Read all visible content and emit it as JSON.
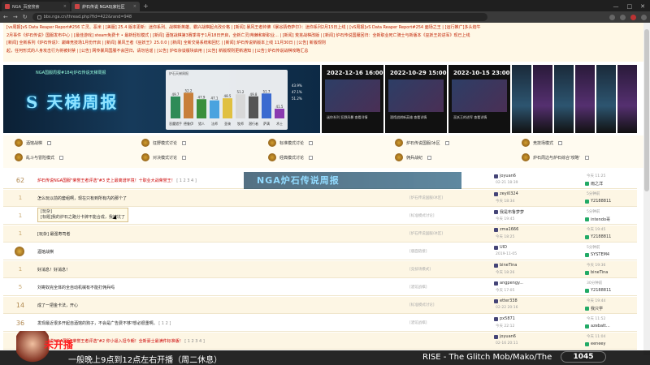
{
  "browser": {
    "tabs": [
      {
        "label": "NGA_百度搜索",
        "active": false
      },
      {
        "label": "炉石传说 NGA玩家社区",
        "active": true
      }
    ],
    "url": "bbs.nga.cn/thread.php?fid=422&rand=948"
  },
  "announce": {
    "lines": [
      "[vs周报]vS Data Reaper Report#256 亡灵、恶米 | [美服] 25.4 版本更新：迷你系列、战棋新英雄、霸兴战棋起点改价格 | [新闻] 暴风王者帅佛《暴谷猜奇萨尔》：迷你系列2月15日上线 | [vS周报]vS Data Reaper Report#254 面场之王 | [运行推广]多头炮牛",
      "2月事件《炉石传说》国服发布中心 | [最佳游戏] steam免费卡 • 最新轻松模式 | [新闻] 酒馆战棋第3赛季将于1月18日开启，全新亡灵/荆棘和新职业... | [新闻] 荒芜战棋改版 | [新闻] 炉石传说国服回归：全新职业死亡骑士与新版本《巫妖王的进军》现已上线",
      "[新闻] 全新系列《炉石传说》：巅峰竞技场1月份开启 | [新闻] 暴风王者《巫妖王》25.0.0 | [新闻] 全新交易系统和回忆 | [新闻] 炉石传说新版本上线 11月30日 | [公告] 新版规则",
      "起，任何形式的人身攻击行为将被封禁 | [公告] 网传暴风国服不会回归，请勿信谣 | [公告] 炉石杂谈版块启用 | [公告] 新版规则更新通知 | [公告] 炉石传说战棋攻略汇总"
    ]
  },
  "banner": {
    "subtitle": "NGA国服周报#184|炉石传说天梯周报",
    "title": "S 天梯周报",
    "panel_header": "炉石天梯周报",
    "class_winrates": [
      49.7,
      52.2,
      47.9,
      47.1,
      48.5,
      51.2,
      49.8,
      51.7,
      41.5
    ],
    "class_labels": [
      "恶魔猎手",
      "德鲁伊",
      "猎人",
      "法师",
      "圣骑",
      "牧师",
      "潜行者",
      "萨满",
      "术士"
    ],
    "pct_labels": [
      "43.9%",
      "47.1%",
      "51.2%"
    ],
    "cards": [
      {
        "date": "2022-12-16 16:00",
        "caption": "迷你系列 狂野风暴 查看详情"
      },
      {
        "date": "2022-10-29 15:00",
        "caption": "酒馆战棋新英雄 查看详情"
      },
      {
        "date": "2022-10-15 23:00",
        "caption": "巫妖王的进军 查看详情"
      }
    ]
  },
  "forums": [
    {
      "name": "酒馆战棋",
      "col": 0,
      "row": 0
    },
    {
      "name": "狂野模式讨论",
      "col": 1,
      "row": 0
    },
    {
      "name": "标准模式讨论",
      "col": 2,
      "row": 0
    },
    {
      "name": "炉石传说国服/冰区",
      "col": 3,
      "row": 0
    },
    {
      "name": "竞技场模式",
      "col": 4,
      "row": 0
    },
    {
      "name": "乱斗与冒险模式",
      "col": 0,
      "row": 1
    },
    {
      "name": "对决模式讨论",
      "col": 1,
      "row": 1
    },
    {
      "name": "经典模式讨论",
      "col": 2,
      "row": 1
    },
    {
      "name": "佣兵战纪",
      "col": 3,
      "row": 1
    },
    {
      "name": "炉石周边与炉石综合'攻略'",
      "col": 4,
      "row": 1
    }
  ],
  "threads": [
    {
      "count": "62",
      "title": "炉石传说NGA国服\"荣誉王者评选\"#3 史上最离谱环境！十职业大战荣誉王！",
      "pages": "[ 1 2 3 4 ]",
      "red": true,
      "forum": "",
      "author": "joyuan6",
      "adate": "02-21 18:39",
      "ltime": "今天 11:25",
      "luser": "雨之洋"
    },
    {
      "count": "1",
      "title": "怎么玩以前的套组啊，现在只有到所有内的那个了",
      "pages": "",
      "red": false,
      "forum": "[炉石传说国服/冰区]",
      "author": "zeyi0324",
      "adate": "今天 18:34",
      "ltime": "5分钟前",
      "luser": "Y2188811"
    },
    {
      "count": "1",
      "title": "[标题]我的炉石之路分卡牌不能合成，我被坑了",
      "pages": "",
      "red": false,
      "forum": "[标准模式讨论]",
      "author": "我是布鲁梦梦",
      "adate": "今天 19:45",
      "ltime": "5分钟前",
      "luser": "intendo哥"
    },
    {
      "count": "1",
      "title": "[玩杂] 最强寿司者",
      "pages": "",
      "red": false,
      "forum": "[炉石传说国服/冰区]",
      "author": "zma1666",
      "adate": "今天 18:25",
      "ltime": "今天 19:45",
      "luser": "Y2188811"
    },
    {
      "count": "",
      "title": "酒馆战棋",
      "pages": "",
      "red": false,
      "forum": "[版面链接]",
      "author": "UID",
      "adate": "2019-11-05",
      "ltime": "5分钟前",
      "luser": "SYSTEM4"
    },
    {
      "count": "1",
      "title": "好消息！好消息！",
      "pages": "",
      "red": false,
      "forum": "[竞技场模式]",
      "author": "bineTina",
      "adate": "今天 18:26",
      "ltime": "今天 19:36",
      "luser": "bineTina"
    },
    {
      "count": "5",
      "title": "刘寄奴完全体的全自动机械有不能打佣兵吗",
      "pages": "",
      "red": false,
      "forum": "[酒馆战棋]",
      "author": "angpengy...",
      "adate": "今天 17:05",
      "ltime": "30分钟前",
      "luser": "Y2188811"
    },
    {
      "count": "14",
      "title": "成了一把金卡法，开心",
      "pages": "",
      "red": false,
      "forum": "[标准模式讨论]",
      "author": "etter338",
      "adate": "02-22 20:16",
      "ltime": "今天 19:44",
      "luser": "我只学"
    },
    {
      "count": "36",
      "title": "发现最近很多开起自酒馆的狗子，不会是广告费不够?想必很重啊。",
      "pages": "[ 1 2 ]",
      "red": false,
      "forum": "[酒馆战棋]",
      "author": "px5871",
      "adate": "今天 22:12",
      "ltime": "今天 11:52",
      "luser": "azebatt..."
    },
    {
      "count": "77",
      "title": "炉石传说NGA国服\"荣誉王者评选\"#2 你小逼入坦今朝！全新豪士最满件标准版！",
      "pages": "[ 1 2 3 4 ]",
      "red": true,
      "forum": "",
      "author": "joyuan6",
      "adate": "02-16 20:11",
      "ltime": "今天 11:04",
      "luser": "eeneey"
    }
  ],
  "thread_strip": "NGA炉石传说周报",
  "tooltip": {
    "line1": "[玩杂]",
    "line2": "[标题]我的炉石之路分卡牌不能合成，我被坑了"
  },
  "overlay": {
    "live": "未开播",
    "schedule": "一般晚上9点到12点左右开播（周二休息）",
    "music": "RISE - The Glitch Mob/Mako/The",
    "counter": "1045"
  }
}
